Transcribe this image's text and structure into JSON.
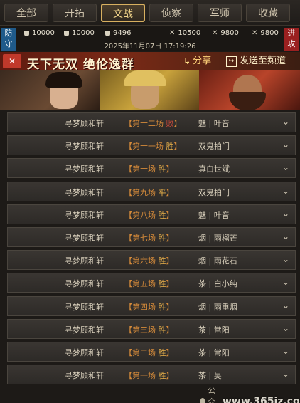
{
  "tabs": [
    {
      "label": "全部"
    },
    {
      "label": "开拓"
    },
    {
      "label": "文战",
      "active": true
    },
    {
      "label": "侦察"
    },
    {
      "label": "军师"
    },
    {
      "label": "收藏"
    }
  ],
  "battle_info": {
    "defense_tag": "防守",
    "attack_tag": "进攻",
    "defense_stats": [
      "10000",
      "10000",
      "9496"
    ],
    "attack_stats": [
      "10500",
      "9800",
      "9800"
    ],
    "timestamp": "2025年11月07日 17:19:26"
  },
  "banner": {
    "title": "天下无双 绝伦逸群",
    "share_label": "分享",
    "send_label": "发送至频道"
  },
  "records": [
    {
      "player": "寻梦顾和轩",
      "round": "【第十二场",
      "result": "败",
      "round_end": "】",
      "opponent": "魅 | 叶音"
    },
    {
      "player": "寻梦顾和轩",
      "round": "【第十一场",
      "result": "胜",
      "round_end": "】",
      "opponent": "双鬼拍门"
    },
    {
      "player": "寻梦顾和轩",
      "round": "【第十场",
      "result": "胜",
      "round_end": "】",
      "opponent": "真白世斌"
    },
    {
      "player": "寻梦顾和轩",
      "round": "【第九场",
      "result": "平",
      "round_end": "】",
      "opponent": "双鬼拍门"
    },
    {
      "player": "寻梦顾和轩",
      "round": "【第八场",
      "result": "胜",
      "round_end": "】",
      "opponent": "魅 | 叶音"
    },
    {
      "player": "寻梦顾和轩",
      "round": "【第七场",
      "result": "胜",
      "round_end": "】",
      "opponent": "烟 | 雨榴芒"
    },
    {
      "player": "寻梦顾和轩",
      "round": "【第六场",
      "result": "胜",
      "round_end": "】",
      "opponent": "烟 | 雨花石"
    },
    {
      "player": "寻梦顾和轩",
      "round": "【第五场",
      "result": "胜",
      "round_end": "】",
      "opponent": "茶 | 白小纯"
    },
    {
      "player": "寻梦顾和轩",
      "round": "【第四场",
      "result": "胜",
      "round_end": "】",
      "opponent": "烟 | 雨重烟"
    },
    {
      "player": "寻梦顾和轩",
      "round": "【第三场",
      "result": "胜",
      "round_end": "】",
      "opponent": "茶 | 常阳"
    },
    {
      "player": "寻梦顾和轩",
      "round": "【第二场",
      "result": "胜",
      "round_end": "】",
      "opponent": "茶 | 常阳"
    },
    {
      "player": "寻梦顾和轩",
      "round": "【第一场",
      "result": "胜",
      "round_end": "】",
      "opponent": "茶 | 吴"
    }
  ],
  "watermark": {
    "text": "公众号",
    "url": "www.365jz.com"
  },
  "icons": {
    "row_expand": "chevron-down-icon",
    "stat_shield": "shield-icon",
    "stat_sword": "crossed-swords-icon",
    "share": "share-icon",
    "send": "send-icon"
  },
  "colors": {
    "active_tab_border": "#d8b060",
    "defense_tag": "#1f5a8a",
    "attack_tag": "#9a2020",
    "round_text": "#d48a3a",
    "lose_text": "#d24a3a"
  }
}
